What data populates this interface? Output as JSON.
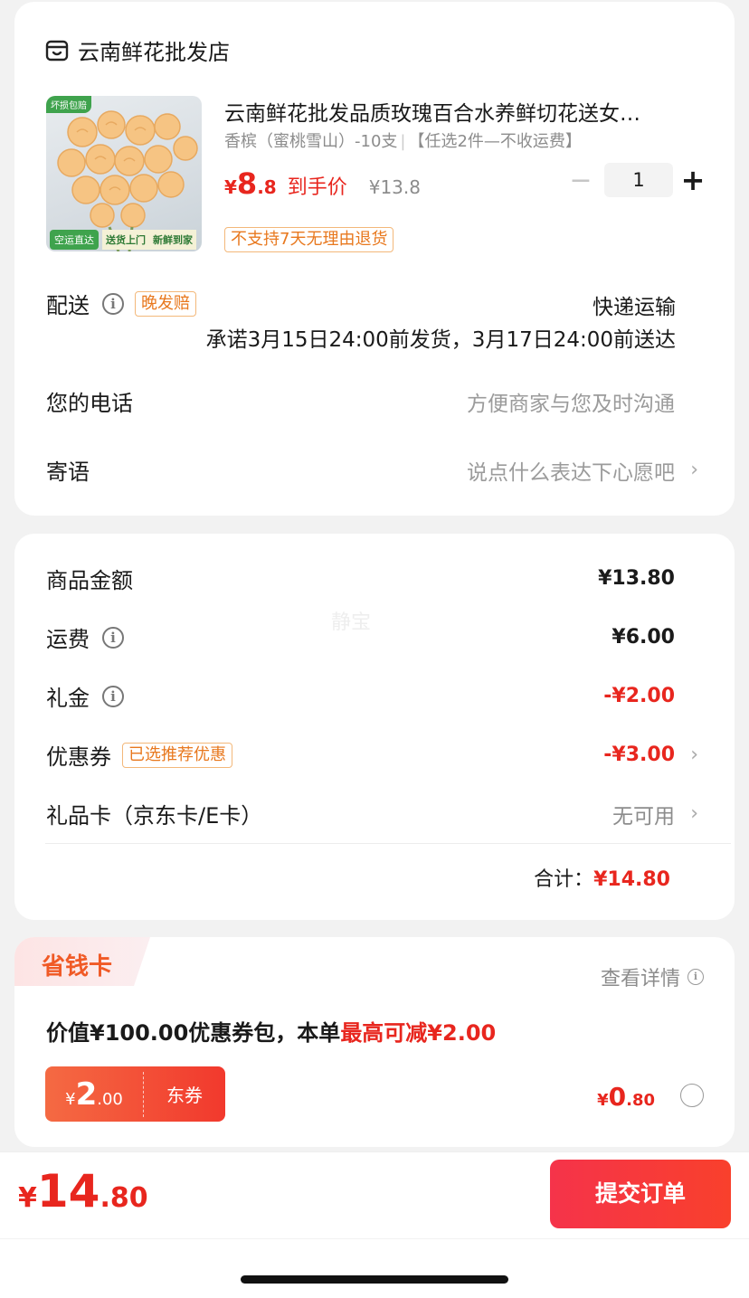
{
  "store": {
    "name": "云南鲜花批发店"
  },
  "product": {
    "image_badge": "坏损包赔",
    "image_footer_1": "空运直达",
    "image_footer_2": "送货上门",
    "image_footer_3": "新鲜到家",
    "title": "云南鲜花批发品质玫瑰百合水养鲜切花送女…",
    "spec": "香槟（蜜桃雪山）-10支",
    "promo": "【任选2件—不收运费】",
    "price_symbol": "¥",
    "price_int": "8",
    "price_dec": ".8",
    "price_label": "到手价",
    "orig_price": "¥13.8",
    "quantity": "1",
    "minus": "−",
    "plus": "+",
    "return_policy": "不支持7天无理由退货"
  },
  "delivery": {
    "label": "配送",
    "tag": "晚发赔",
    "method": "快递运输",
    "promise": "承诺3月15日24:00前发货，3月17日24:00前送达"
  },
  "phone": {
    "label": "您的电话",
    "placeholder": "方便商家与您及时沟通"
  },
  "message": {
    "label": "寄语",
    "placeholder": "说点什么表达下心愿吧"
  },
  "summary": {
    "watermark": "静宝",
    "goods_label": "商品金额",
    "goods_value": "¥13.80",
    "shipping_label": "运费",
    "shipping_value": "¥6.00",
    "gift_label": "礼金",
    "gift_value": "-¥2.00",
    "coupon_label": "优惠券",
    "coupon_tag": "已选推荐优惠",
    "coupon_value": "-¥3.00",
    "giftcard_label": "礼品卡（京东卡/E卡）",
    "giftcard_value": "无可用",
    "total_label": "合计：",
    "total_value": "¥14.80"
  },
  "savecard": {
    "title": "省钱卡",
    "details": "查看详情",
    "desc_prefix": "价值¥100.00优惠券包，本单",
    "desc_highlight": "最高可减¥2.00",
    "coupon_symbol": "¥",
    "coupon_int": "2",
    "coupon_dec": ".00",
    "coupon_type": "东券",
    "price_symbol": "¥",
    "price_int": "0",
    "price_dec": ".80"
  },
  "footer": {
    "total_symbol": "¥",
    "total_int": "14",
    "total_dec": ".80",
    "submit": "提交订单"
  },
  "colors": {
    "accent": "#e8261e",
    "tag_orange": "#e8781e",
    "submit_start": "#f5334a",
    "submit_end": "#f9402c"
  }
}
